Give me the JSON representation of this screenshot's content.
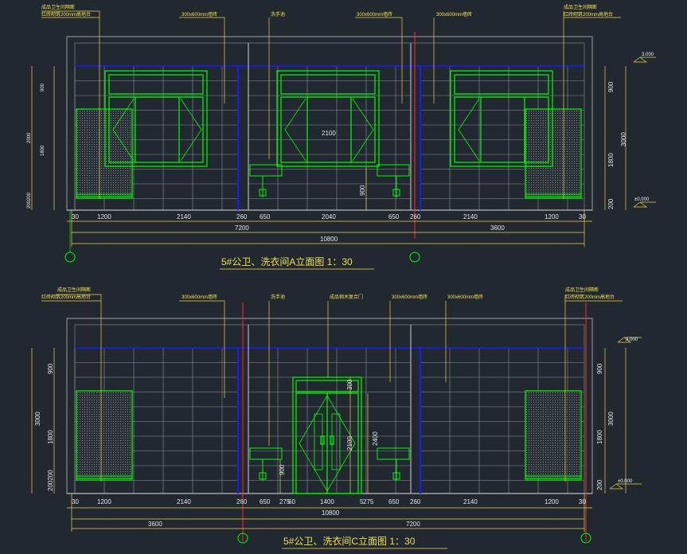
{
  "drawing_a": {
    "title": "5#公卫、洗衣间A立面图 1：30",
    "notes": [
      {
        "text": "成品卫生间隔断"
      },
      {
        "text": "红砖砌筑200mm高地台"
      },
      {
        "text": "300x600mm墙砖"
      },
      {
        "text": "洗手池"
      },
      {
        "text": "300x600mm墙砖"
      },
      {
        "text": "300x600mm墙砖"
      },
      {
        "text": "成品卫生间隔断"
      },
      {
        "text": "红砖砌筑200mm高地台"
      }
    ],
    "bottom_dims": [
      "30",
      "1200",
      "2140",
      "260",
      "650",
      "2040",
      "650",
      "260",
      "2140",
      "1200",
      "30"
    ],
    "overall_dims": [
      "7200",
      "3600",
      "10800"
    ],
    "inner_dims": [
      "2100",
      "900"
    ],
    "left_dims": [
      "900",
      "1800",
      "2000",
      "200200"
    ],
    "right_dims": [
      "900",
      "1800",
      "3000",
      "200"
    ],
    "elevations": [
      "3.000",
      "±0.000"
    ]
  },
  "drawing_c": {
    "title": "5#公卫、洗衣间C立面图  1：30",
    "notes": [
      {
        "text": "成品卫生间隔断"
      },
      {
        "text": "红砖砌筑200mm高地台"
      },
      {
        "text": "300x600mm墙砖"
      },
      {
        "text": "洗手池"
      },
      {
        "text": "成品钢木复合门"
      },
      {
        "text": "300x600mm墙砖"
      },
      {
        "text": "300x600mm墙砖"
      },
      {
        "text": "成品卫生间隔断"
      },
      {
        "text": "红砖砌筑200mm高地台"
      }
    ],
    "bottom_dims": [
      "30",
      "1200",
      "2140",
      "260",
      "650",
      "275",
      "60",
      "1400",
      "5",
      "275",
      "650",
      "260",
      "2140",
      "1200",
      "30"
    ],
    "overall_dims": [
      "3600",
      "10800",
      "7200"
    ],
    "inner_dims": [
      "300",
      "2400",
      "2100",
      "900"
    ],
    "left_dims": [
      "900",
      "1800",
      "3000",
      "200200"
    ],
    "right_dims": [
      "900",
      "1800",
      "3000",
      "200"
    ],
    "elevations": [
      "3.000",
      "±0.000"
    ]
  },
  "colors": {
    "background": "#212830",
    "partition_green": "#00ff00",
    "dimension_yellow": "#e8d24a",
    "ceiling_blue": "#1a1aff",
    "red_axis": "#ff2a2a",
    "grid_gray": "#8a8f96"
  }
}
